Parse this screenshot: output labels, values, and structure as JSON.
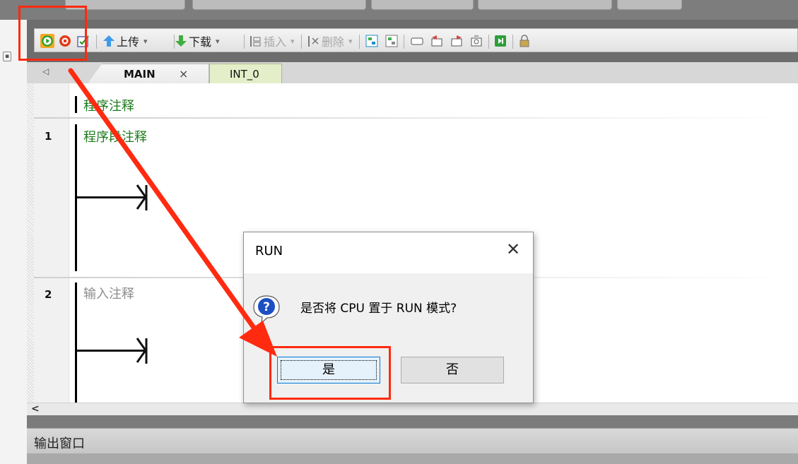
{
  "toolbar": {
    "run_button": "RUN",
    "stop_button": "STOP",
    "compile_button": "Compile",
    "upload_label": "上传",
    "download_label": "下载",
    "insert_label": "插入",
    "delete_label": "删除"
  },
  "tabs": [
    {
      "label": "MAIN",
      "close": "×"
    },
    {
      "label": "INT_0"
    }
  ],
  "tabbar": {
    "scroll_left": "◁"
  },
  "editor": {
    "program_comment": "程序注释",
    "networks": [
      {
        "number": "1",
        "comment": "程序段注释"
      },
      {
        "number": "2",
        "comment": "输入注释"
      }
    ]
  },
  "scrollbar": {
    "left_arrow": "<"
  },
  "output": {
    "title": "输出窗口"
  },
  "dialog": {
    "title": "RUN",
    "close": "✕",
    "message": "是否将 CPU 置于 RUN 模式?",
    "yes": "是",
    "no": "否",
    "icon": "question-icon"
  },
  "colors": {
    "highlight": "#ff2a10",
    "comment_green": "#1a7a1a",
    "run_green": "#22a022",
    "stop_red": "#e23b18"
  }
}
